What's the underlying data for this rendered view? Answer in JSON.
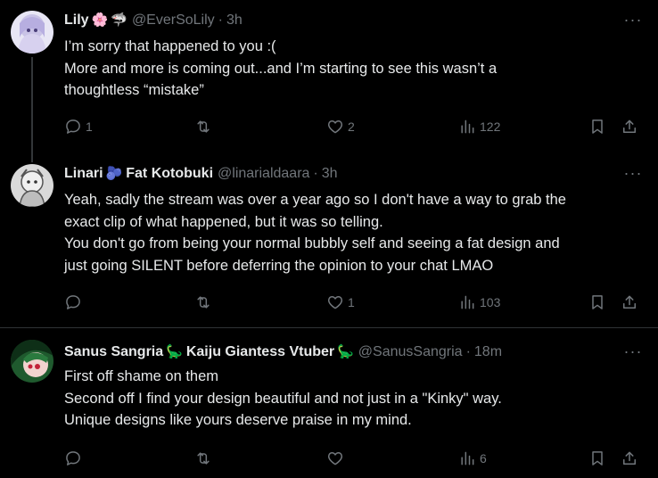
{
  "colors": {
    "background": "#000000",
    "text": "#e7e9ea",
    "muted": "#71767b",
    "divider": "#2f3336"
  },
  "tweets": [
    {
      "display_name": "Lily",
      "name_emojis": [
        "🌸",
        "🦈"
      ],
      "handle": "@EverSoLily",
      "separator": "·",
      "time": "3h",
      "more_icon": "ellipsis-icon",
      "lines": [
        "I’m sorry that happened to you :(",
        "More and more is coming out...and I’m starting to see this wasn’t a",
        "thoughtless “mistake”"
      ],
      "actions": {
        "replies": "1",
        "reposts": "",
        "likes": "2",
        "views": "122"
      }
    },
    {
      "display_name": "Linari",
      "name_emojis": [
        "🫐"
      ],
      "display_name_suffix": "Fat Kotobuki",
      "handle": "@linarialdaara",
      "separator": "·",
      "time": "3h",
      "more_icon": "ellipsis-icon",
      "lines": [
        "Yeah, sadly the stream was over a year ago so I don't have a way to grab the",
        "exact clip of what happened, but it was so telling.",
        "You don't go from being your normal bubbly self and seeing a fat design and",
        "just going SILENT before deferring the opinion to your chat LMAO"
      ],
      "actions": {
        "replies": "",
        "reposts": "",
        "likes": "1",
        "views": "103"
      }
    },
    {
      "display_name": "Sanus Sangria",
      "name_emojis": [
        "🦕"
      ],
      "display_name_suffix": "Kaiju Giantess Vtuber",
      "name_emojis_end": [
        "🦕"
      ],
      "handle": "@SanusSangria",
      "separator": "·",
      "time": "18m",
      "more_icon": "ellipsis-icon",
      "lines": [
        "First off shame on them",
        "Second off I find your design beautiful and not just in a \"Kinky\" way.",
        "Unique designs like yours deserve praise in my mind."
      ],
      "actions": {
        "replies": "",
        "reposts": "",
        "likes": "",
        "views": "6"
      }
    }
  ]
}
